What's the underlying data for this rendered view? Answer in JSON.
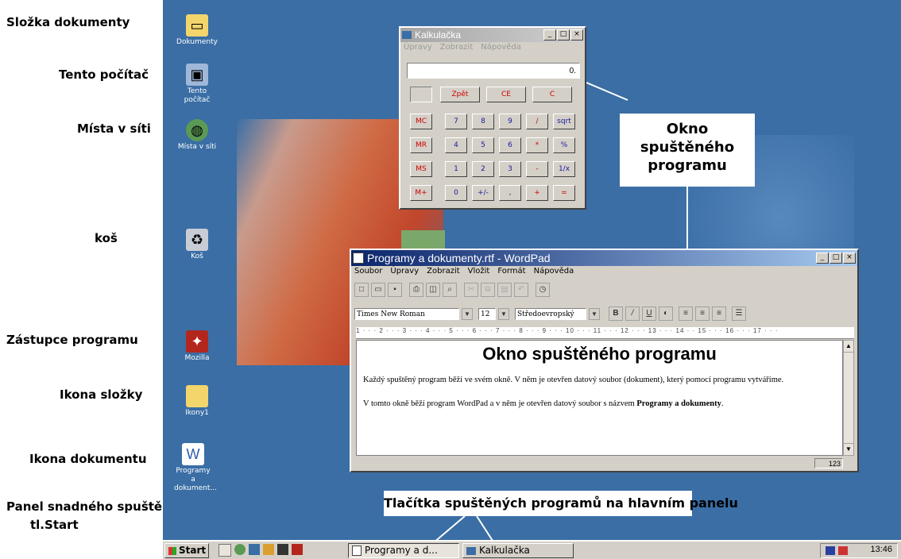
{
  "annotations": {
    "folder_documents": "Složka dokumenty",
    "this_computer": "Tento počítač",
    "network_places": "Místa v síti",
    "recycle_bin": "koš",
    "program_shortcut": "Zástupce programu",
    "folder_icon": "Ikona složky",
    "document_icon": "Ikona dokumentu",
    "quick_launch_line1_a": "Panel snadného spu",
    "quick_launch_line1_b": "štění",
    "quick_launch_line1_c": ",",
    "start_button_note": "tl.Start",
    "running_window_1": "Okno",
    "running_window_2": "spuštěného",
    "running_window_3": "programu",
    "taskbar_buttons_note": "Tlačítka spuštěných programů na hlavním panelu"
  },
  "desktop_icons": [
    {
      "label": "Dokumenty",
      "icon": "folder-documents-icon"
    },
    {
      "label": "Tento počítač",
      "icon": "computer-icon"
    },
    {
      "label": "Místa v síti",
      "icon": "network-icon"
    },
    {
      "label": "Koš",
      "icon": "recycle-bin-icon"
    },
    {
      "label": "Mozilla",
      "icon": "mozilla-icon"
    },
    {
      "label": "Ikony1",
      "icon": "folder-icon"
    },
    {
      "label": "Programy a dokument...",
      "icon": "document-icon"
    }
  ],
  "calculator": {
    "title": "Kalkulačka",
    "menu": [
      "Úpravy",
      "Zobrazit",
      "Nápověda"
    ],
    "display": "0.",
    "top_buttons": [
      "Zpět",
      "CE",
      "C"
    ],
    "memory_buttons": [
      "MC",
      "MR",
      "MS",
      "M+"
    ],
    "rows": [
      [
        "7",
        "8",
        "9",
        "/",
        "sqrt"
      ],
      [
        "4",
        "5",
        "6",
        "*",
        "%"
      ],
      [
        "1",
        "2",
        "3",
        "-",
        "1/x"
      ],
      [
        "0",
        "+/-",
        ",",
        "+",
        "="
      ]
    ]
  },
  "wordpad": {
    "title": "Programy a dokumenty.rtf - WordPad",
    "menu": [
      "Soubor",
      "Úpravy",
      "Zobrazit",
      "Vložit",
      "Formát",
      "Nápověda"
    ],
    "font": "Times New Roman",
    "size": "12",
    "script": "Středoevropský",
    "format_buttons": [
      "B",
      "/",
      "U"
    ],
    "ruler": "1 · · · 2 · · · 3 · · · 4 · · · 5 · · · 6 · · · 7 · · · 8 · · · 9 · · · 10 · · · 11 · · · 12 · · · 13 · · · 14 · · 15 · · · 16 · · · 17 · · ·",
    "doc_heading": "Okno spuštěného programu",
    "doc_para1": "Každý spuštěný program běží ve svém okně. V něm je otevřen datový soubor (dokument), který pomocí programu vytváříme.",
    "doc_para2_start": "V tomto okně běží program WordPad a v něm je otevřen datový soubor s názvem ",
    "doc_para2_bold": "Programy a dokumenty",
    "doc_para2_end": ".",
    "status_num": "123"
  },
  "taskbar": {
    "start": "Start",
    "items": [
      "Programy a d...",
      "Kalkulačka"
    ],
    "clock": "13:46"
  }
}
